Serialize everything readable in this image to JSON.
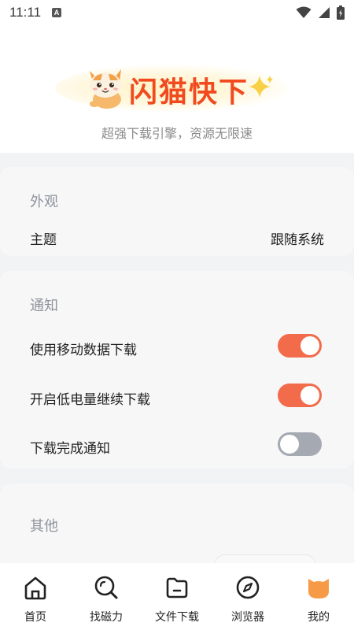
{
  "status_bar": {
    "time": "11:11",
    "indicator": "A"
  },
  "header": {
    "app_name": "闪猫快下",
    "tagline": "超强下载引擎，资源无限速",
    "brand_color": "#f04a1e"
  },
  "sections": {
    "appearance": {
      "title": "外观",
      "theme_label": "主题",
      "theme_value": "跟随系统"
    },
    "notification": {
      "title": "通知",
      "items": [
        {
          "label": "使用移动数据下载",
          "on": true
        },
        {
          "label": "开启低电量继续下载",
          "on": true
        },
        {
          "label": "下载完成通知",
          "on": false
        }
      ]
    },
    "other": {
      "title": "其他"
    }
  },
  "bottom_nav": [
    {
      "label": "首页",
      "icon": "home-icon"
    },
    {
      "label": "找磁力",
      "icon": "search-icon"
    },
    {
      "label": "文件下载",
      "icon": "folder-icon"
    },
    {
      "label": "浏览器",
      "icon": "compass-icon"
    },
    {
      "label": "我的",
      "icon": "cat-head-icon"
    }
  ],
  "colors": {
    "accent": "#f26b4b",
    "toggle_off": "#a5a9b2"
  }
}
